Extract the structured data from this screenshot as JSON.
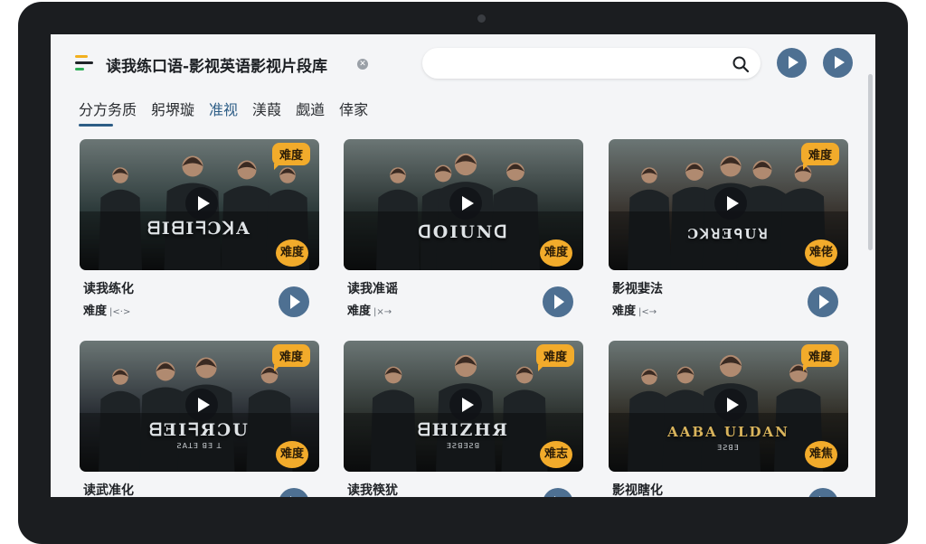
{
  "app": {
    "title": "读我练口语-影视英语影视片段库"
  },
  "search": {
    "value": "",
    "placeholder": ""
  },
  "tabs": [
    {
      "label": "分方务质"
    },
    {
      "label": "躬堺璇"
    },
    {
      "label": "准视"
    },
    {
      "label": "渼葭"
    },
    {
      "label": "觑遒"
    },
    {
      "label": "倖家"
    }
  ],
  "active_tab_index": 2,
  "cards": [
    {
      "title": "读我练化",
      "meta_label": "难度",
      "meta_arrows": "|<·>",
      "poster_title": "ᗺIᗺIᖷƆꓘA",
      "poster_sub": "",
      "badge_top": "难度",
      "badge_bottom": "难度",
      "theme": "#2c3a3a"
    },
    {
      "title": "读我准谣",
      "meta_label": "难度",
      "meta_arrows": "|×→",
      "poster_title": "ꓷOIUNᗡ",
      "poster_sub": "",
      "badge_top": "",
      "badge_bottom": "难度",
      "theme": "#27302f"
    },
    {
      "title": "影视婓法",
      "meta_label": "难度",
      "meta_arrows": "|<→",
      "poster_title": "ƆꓘꓤƎᑫUꓤ",
      "poster_sub": "",
      "badge_top": "难度",
      "badge_bottom": "难佬",
      "theme": "#3a3530"
    },
    {
      "title": "读武准化",
      "meta_label": "",
      "meta_arrows": "",
      "poster_title": "ᗺƎIᖷЯƆU",
      "poster_sub": "ƧAꓕƎ ꓭƎ ꓕ",
      "badge_top": "难度",
      "badge_bottom": "难度",
      "theme": "#2a2f35"
    },
    {
      "title": "读我筷犹",
      "meta_label": "",
      "meta_arrows": "",
      "poster_title": "ᗺHIZHЯ",
      "poster_sub": "ƎƧꓭƎƧꓭ",
      "badge_top": "难度",
      "badge_bottom": "难志",
      "theme": "#2e3431"
    },
    {
      "title": "影视瞎化",
      "meta_label": "",
      "meta_arrows": "",
      "poster_title": "AABA ULDAN",
      "poster_sub": "ƎƧꓭƎ",
      "badge_top": "难度",
      "badge_bottom": "难焦",
      "theme": "#33312a"
    }
  ]
}
